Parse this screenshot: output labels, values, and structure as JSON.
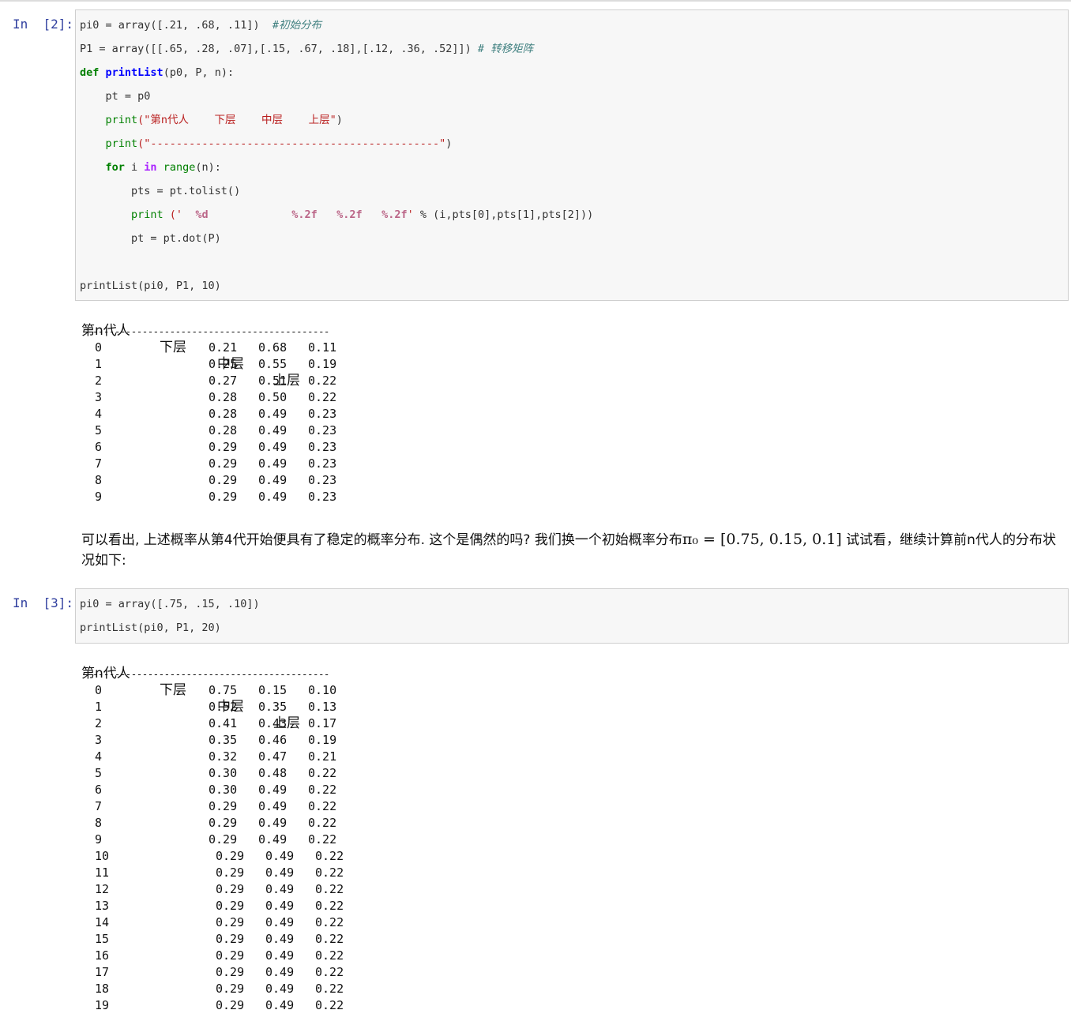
{
  "cells": [
    {
      "prompt": "In  [2]:",
      "code": {
        "l1_var": "pi0 = array([.21, .68, .11])  ",
        "l1_comment": "#初始分布",
        "l2_var": "P1 = array([[.65, .28, .07],[.15, .67, .18],[.12, .36, .52]]) ",
        "l2_comment": "# 转移矩阵",
        "l3_def": "def",
        "l3_name": "printList",
        "l3_rest": "(p0, P, n):",
        "l4": "    pt = p0",
        "l5_print": "print",
        "l5_str": "(\"第n代人    下层    中层    上层\"",
        "l5_end": ")",
        "l6_print": "print",
        "l6_str": "(\"---------------------------------------------\"",
        "l6_end": ")",
        "l7_for": "for",
        "l7_i": " i ",
        "l7_in": "in",
        "l7_range": " range",
        "l7_rest": "(n):",
        "l8": "        pts = pt.tolist()",
        "l9_print": "print",
        "l9_s1": " ('  ",
        "l9_f1": "%d",
        "l9_s2": "             ",
        "l9_f2": "%.2f",
        "l9_s3": "   ",
        "l9_f3": "%.2f",
        "l9_s4": "   ",
        "l9_f4": "%.2f",
        "l9_s5": "'",
        "l9_rest": " % (i,pts[0],pts[1],pts[2]))",
        "l10": "        pt = pt.dot(P)",
        "l11": "printList(pi0, P1, 10)"
      },
      "output": {
        "headers": [
          "第n代人",
          "下层",
          "中层",
          "上层"
        ],
        "divider": "---------------------------------------------",
        "rows": [
          [
            "0",
            "0.21",
            "0.68",
            "0.11"
          ],
          [
            "1",
            "0.25",
            "0.55",
            "0.19"
          ],
          [
            "2",
            "0.27",
            "0.51",
            "0.22"
          ],
          [
            "3",
            "0.28",
            "0.50",
            "0.22"
          ],
          [
            "4",
            "0.28",
            "0.49",
            "0.23"
          ],
          [
            "5",
            "0.28",
            "0.49",
            "0.23"
          ],
          [
            "6",
            "0.29",
            "0.49",
            "0.23"
          ],
          [
            "7",
            "0.29",
            "0.49",
            "0.23"
          ],
          [
            "8",
            "0.29",
            "0.49",
            "0.23"
          ],
          [
            "9",
            "0.29",
            "0.49",
            "0.23"
          ]
        ]
      }
    },
    {
      "prompt": "In  [3]:",
      "code": {
        "l1": "pi0 = array([.75, .15, .10])",
        "l2": "printList(pi0, P1, 20)"
      },
      "output": {
        "headers": [
          "第n代人",
          "下层",
          "中层",
          "上层"
        ],
        "divider": "---------------------------------------------",
        "rows": [
          [
            "0",
            "0.75",
            "0.15",
            "0.10"
          ],
          [
            "1",
            "0.52",
            "0.35",
            "0.13"
          ],
          [
            "2",
            "0.41",
            "0.43",
            "0.17"
          ],
          [
            "3",
            "0.35",
            "0.46",
            "0.19"
          ],
          [
            "4",
            "0.32",
            "0.47",
            "0.21"
          ],
          [
            "5",
            "0.30",
            "0.48",
            "0.22"
          ],
          [
            "6",
            "0.30",
            "0.49",
            "0.22"
          ],
          [
            "7",
            "0.29",
            "0.49",
            "0.22"
          ],
          [
            "8",
            "0.29",
            "0.49",
            "0.22"
          ],
          [
            "9",
            "0.29",
            "0.49",
            "0.22"
          ],
          [
            "10",
            "0.29",
            "0.49",
            "0.22"
          ],
          [
            "11",
            "0.29",
            "0.49",
            "0.22"
          ],
          [
            "12",
            "0.29",
            "0.49",
            "0.22"
          ],
          [
            "13",
            "0.29",
            "0.49",
            "0.22"
          ],
          [
            "14",
            "0.29",
            "0.49",
            "0.22"
          ],
          [
            "15",
            "0.29",
            "0.49",
            "0.22"
          ],
          [
            "16",
            "0.29",
            "0.49",
            "0.22"
          ],
          [
            "17",
            "0.29",
            "0.49",
            "0.22"
          ],
          [
            "18",
            "0.29",
            "0.49",
            "0.22"
          ],
          [
            "19",
            "0.29",
            "0.49",
            "0.22"
          ]
        ]
      }
    }
  ],
  "markdown": {
    "text_before": "可以看出, 上述概率从第4代开始便具有了稳定的概率分布. 这个是偶然的吗? 我们换一个初始概率分布",
    "math": "π₀ = [0.75, 0.15, 0.1]",
    "text_after": " 试试看，继续计算前n代人的分布状况如下:"
  }
}
